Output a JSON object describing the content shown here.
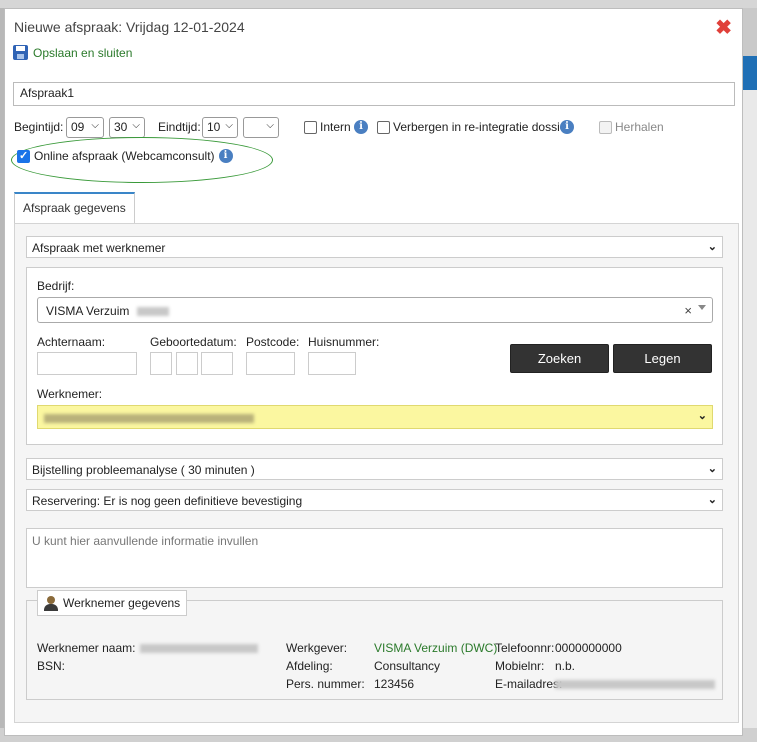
{
  "dialog": {
    "title": "Nieuwe afspraak: Vrijdag 12-01-2024",
    "close_label": "✖",
    "save_label": "Opslaan en sluiten"
  },
  "subject": {
    "value": "Afspraak1"
  },
  "time": {
    "begin_label": "Begintijd:",
    "begin_hour": "09",
    "begin_min": "30",
    "end_label": "Eindtijd:",
    "end_hour": "10",
    "end_min": ""
  },
  "options": {
    "intern_label": "Intern",
    "hide_label": "Verbergen in re-integratie dossier",
    "repeat_label": "Herhalen",
    "online_label": "Online afspraak (Webcamconsult)",
    "info_glyph": "i"
  },
  "tab": {
    "label": "Afspraak gegevens"
  },
  "form": {
    "type_select": "Afspraak met werknemer",
    "bedrijf_label": "Bedrijf:",
    "bedrijf_value": "VISMA Verzuim",
    "achternaam_label": "Achternaam:",
    "geboortedatum_label": "Geboortedatum:",
    "postcode_label": "Postcode:",
    "huisnummer_label": "Huisnummer:",
    "search_button": "Zoeken",
    "clear_button": "Legen",
    "werknemer_label": "Werknemer:",
    "analysis_select": "Bijstelling probleemanalyse ( 30 minuten )",
    "reservation_select": "Reservering: Er is nog geen definitieve bevestiging",
    "notes_placeholder": "U kunt hier aanvullende informatie invullen"
  },
  "employee": {
    "tab_label": "Werknemer gegevens",
    "name_label": "Werknemer naam:",
    "bsn_label": "BSN:",
    "employer_label": "Werkgever:",
    "employer_value": "VISMA Verzuim (DWC)",
    "department_label": "Afdeling:",
    "department_value": "Consultancy",
    "pers_label": "Pers. nummer:",
    "pers_value": "123456",
    "phone_label": "Telefoonnr:",
    "phone_value": "0000000000",
    "mobile_label": "Mobielnr:",
    "mobile_value": "n.b.",
    "email_label": "E-mailadres:"
  },
  "colors": {
    "accent": "#3a86c8",
    "save_green": "#2b7a2b",
    "highlight": "#fbf7a0",
    "close_red": "#e0403a"
  }
}
